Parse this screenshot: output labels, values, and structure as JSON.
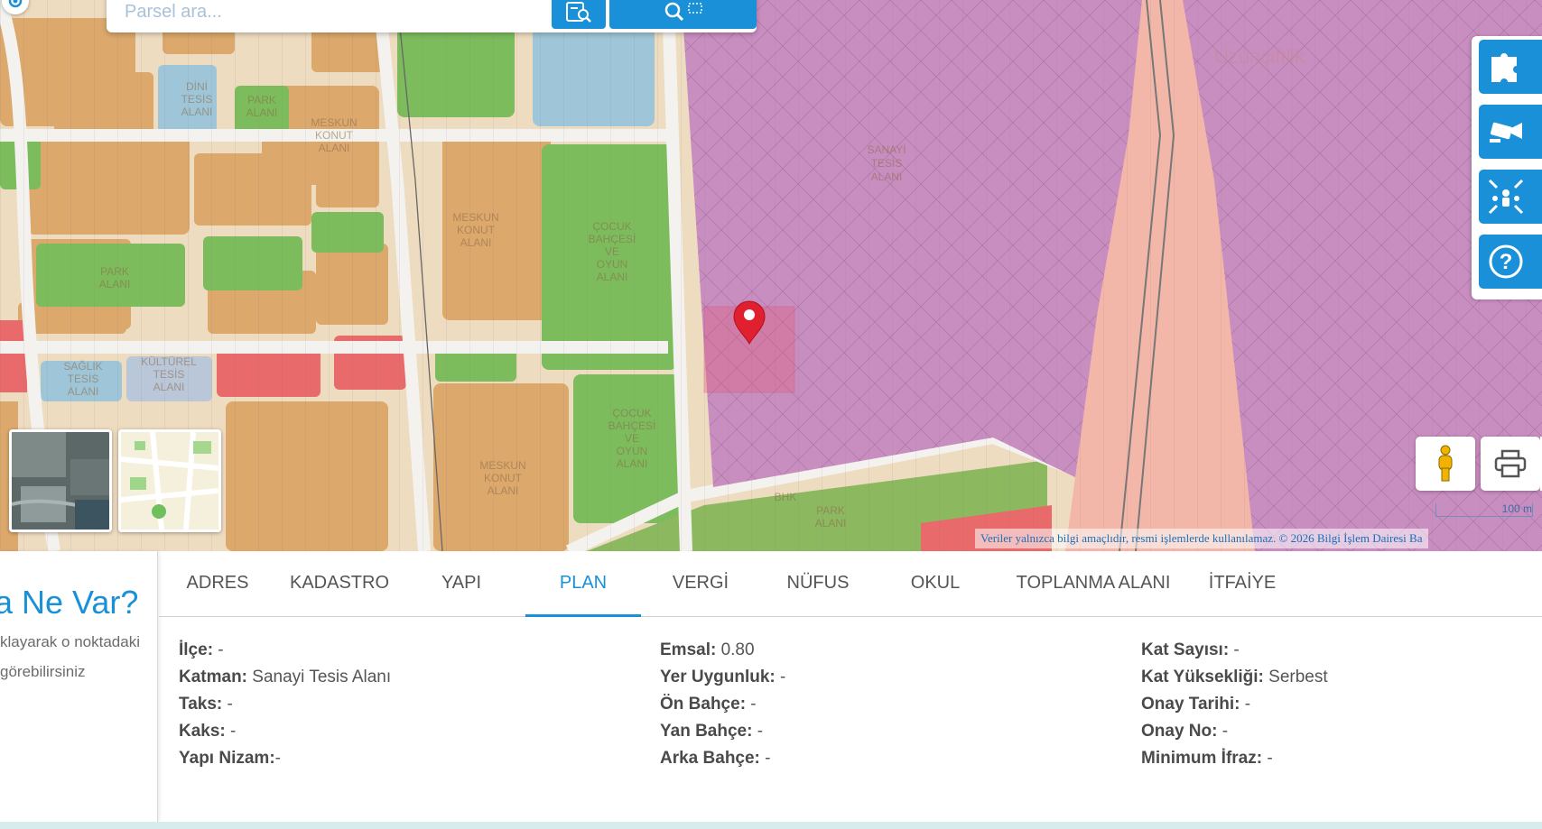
{
  "search": {
    "placeholder": "Parsel ara..."
  },
  "icons": {
    "locate": "locate-icon",
    "parcel_search": "parcel-search-icon",
    "search": "search-icon",
    "puzzle": "puzzle-icon",
    "camera": "camera-icon",
    "gathering": "gathering-area-icon",
    "help": "help-icon",
    "pegman": "pegman-icon",
    "print": "print-icon",
    "marker": "map-marker-icon"
  },
  "map": {
    "attribution": "Veriler yalnızca bilgi amaçlıdır, resmi işlemlerde kullanılamaz. © 2026 Bilgi İşlem Dairesi Ba",
    "scale_label": "100 m",
    "labels": {
      "uzunciftlik": "Uzunçiftlik",
      "dini": [
        "DİNİ",
        "TESİS",
        "ALANI"
      ],
      "park1": [
        "PARK",
        "ALANI"
      ],
      "mesk1": [
        "MESKUN",
        "KONUT",
        "ALANI"
      ],
      "mesk2": [
        "MESKUN",
        "KONUT",
        "ALANI"
      ],
      "mesk3": [
        "MESKUN",
        "KONUT",
        "ALANI"
      ],
      "cocuk1": [
        "ÇOCUK",
        "BAHÇESİ",
        "VE",
        "OYUN",
        "ALANI"
      ],
      "cocuk2": [
        "ÇOCUK",
        "BAHÇESİ",
        "VE",
        "OYUN",
        "ALANI"
      ],
      "sanayi": [
        "SANAYİ",
        "TESİS",
        "ALANI"
      ],
      "kultur": [
        "KÜLTÜREL",
        "TESİS",
        "ALANI"
      ],
      "saglik": [
        "SAĞLIK",
        "TESİS",
        "ALANI"
      ],
      "park2": [
        "PARK",
        "ALANI"
      ],
      "park3": [
        "PARK",
        "ALANI"
      ],
      "bhk": "BHK"
    }
  },
  "left_panel": {
    "title": "a Ne Var?",
    "line1": "klayarak o noktadaki",
    "line2": "görebilirsiniz"
  },
  "tabs": [
    {
      "label": "ADRES"
    },
    {
      "label": "KADASTRO"
    },
    {
      "label": "YAPI"
    },
    {
      "label": "PLAN"
    },
    {
      "label": "VERGİ"
    },
    {
      "label": "NÜFUS"
    },
    {
      "label": "OKUL"
    },
    {
      "label": "TOPLANMA ALANI"
    },
    {
      "label": "İTFAİYE"
    }
  ],
  "active_tab": "PLAN",
  "plan": {
    "col1": [
      {
        "label": "İlçe:",
        "value": " -"
      },
      {
        "label": "Katman:",
        "value": " Sanayi Tesis Alanı"
      },
      {
        "label": "Taks:",
        "value": " -"
      },
      {
        "label": "Kaks:",
        "value": " -"
      },
      {
        "label": "Yapı Nizam:",
        "value": "-"
      }
    ],
    "col2": [
      {
        "label": "Emsal:",
        "value": " 0.80"
      },
      {
        "label": "Yer Uygunluk:",
        "value": " -"
      },
      {
        "label": "Ön Bahçe:",
        "value": " -"
      },
      {
        "label": "Yan Bahçe:",
        "value": " -"
      },
      {
        "label": "Arka Bahçe:",
        "value": " -"
      }
    ],
    "col3": [
      {
        "label": "Kat Sayısı:",
        "value": " -"
      },
      {
        "label": "Kat Yüksekliği:",
        "value": " Serbest"
      },
      {
        "label": "Onay Tarihi:",
        "value": " -"
      },
      {
        "label": "Onay No:",
        "value": " -"
      },
      {
        "label": "Minimum İfraz:",
        "value": " -"
      }
    ]
  },
  "colors": {
    "accent": "#1a90d8",
    "industrial": "#c98ec0",
    "residential": "#dba86a",
    "park": "#7cbc5c",
    "religious": "#9fc6d8",
    "public": "#e86a6a",
    "rail_corridor": "#f2b7a8",
    "marker": "#e0202e"
  }
}
